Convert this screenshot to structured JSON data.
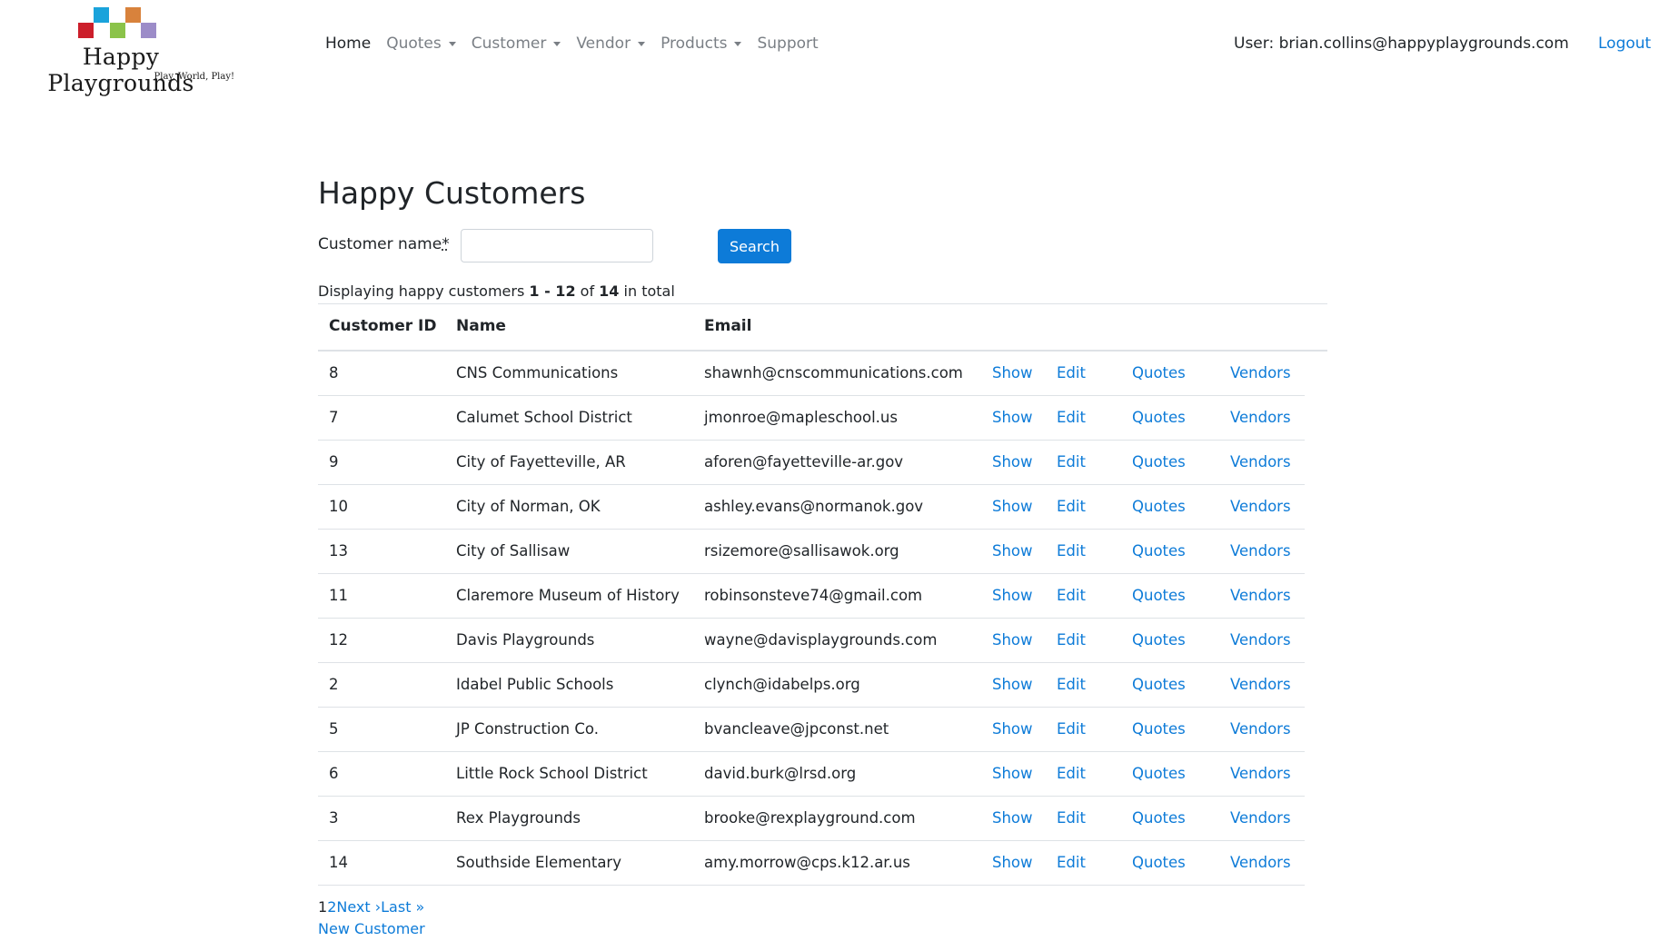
{
  "brand": {
    "name": "Happy Playgrounds",
    "tagline": "Play, World, Play!",
    "colors": [
      "#cc1f2b",
      "#1aa3db",
      "#8bc34a",
      "#d8823c",
      "#9c8cc8"
    ]
  },
  "nav": {
    "home": "Home",
    "quotes": "Quotes",
    "customer": "Customer",
    "vendor": "Vendor",
    "products": "Products",
    "support": "Support"
  },
  "user": {
    "label": "User: brian.collins@happyplaygrounds.com",
    "logout": "Logout"
  },
  "page": {
    "title": "Happy Customers"
  },
  "search": {
    "label": "Customer name",
    "required_mark": "*",
    "value": "",
    "placeholder": "",
    "button": "Search"
  },
  "summary": {
    "prefix": "Displaying happy customers ",
    "range": "1 - 12",
    "of": " of ",
    "total": "14",
    "suffix": " in total"
  },
  "table": {
    "headers": [
      "Customer ID",
      "Name",
      "Email"
    ],
    "actions": [
      "Show",
      "Edit",
      "Quotes",
      "Vendors"
    ],
    "rows": [
      {
        "id": "8",
        "name": "CNS Communications",
        "email": "shawnh@cnscommunications.com"
      },
      {
        "id": "7",
        "name": "Calumet School District",
        "email": "jmonroe@mapleschool.us"
      },
      {
        "id": "9",
        "name": "City of Fayetteville, AR",
        "email": "aforen@fayetteville-ar.gov"
      },
      {
        "id": "10",
        "name": "City of Norman, OK",
        "email": "ashley.evans@normanok.gov"
      },
      {
        "id": "13",
        "name": "City of Sallisaw",
        "email": "rsizemore@sallisawok.org"
      },
      {
        "id": "11",
        "name": "Claremore Museum of History",
        "email": "robinsonsteve74@gmail.com"
      },
      {
        "id": "12",
        "name": "Davis Playgrounds",
        "email": "wayne@davisplaygrounds.com"
      },
      {
        "id": "2",
        "name": "Idabel Public Schools",
        "email": "clynch@idabelps.org"
      },
      {
        "id": "5",
        "name": "JP Construction Co.",
        "email": "bvancleave@jpconst.net"
      },
      {
        "id": "6",
        "name": "Little Rock School District",
        "email": "david.burk@lrsd.org"
      },
      {
        "id": "3",
        "name": "Rex Playgrounds",
        "email": "brooke@rexplayground.com"
      },
      {
        "id": "14",
        "name": "Southside Elementary",
        "email": "amy.morrow@cps.k12.ar.us"
      }
    ]
  },
  "pagination": {
    "current": "1",
    "page2": "2",
    "next": "Next ›",
    "last": "Last »"
  },
  "new_customer": "New Customer"
}
